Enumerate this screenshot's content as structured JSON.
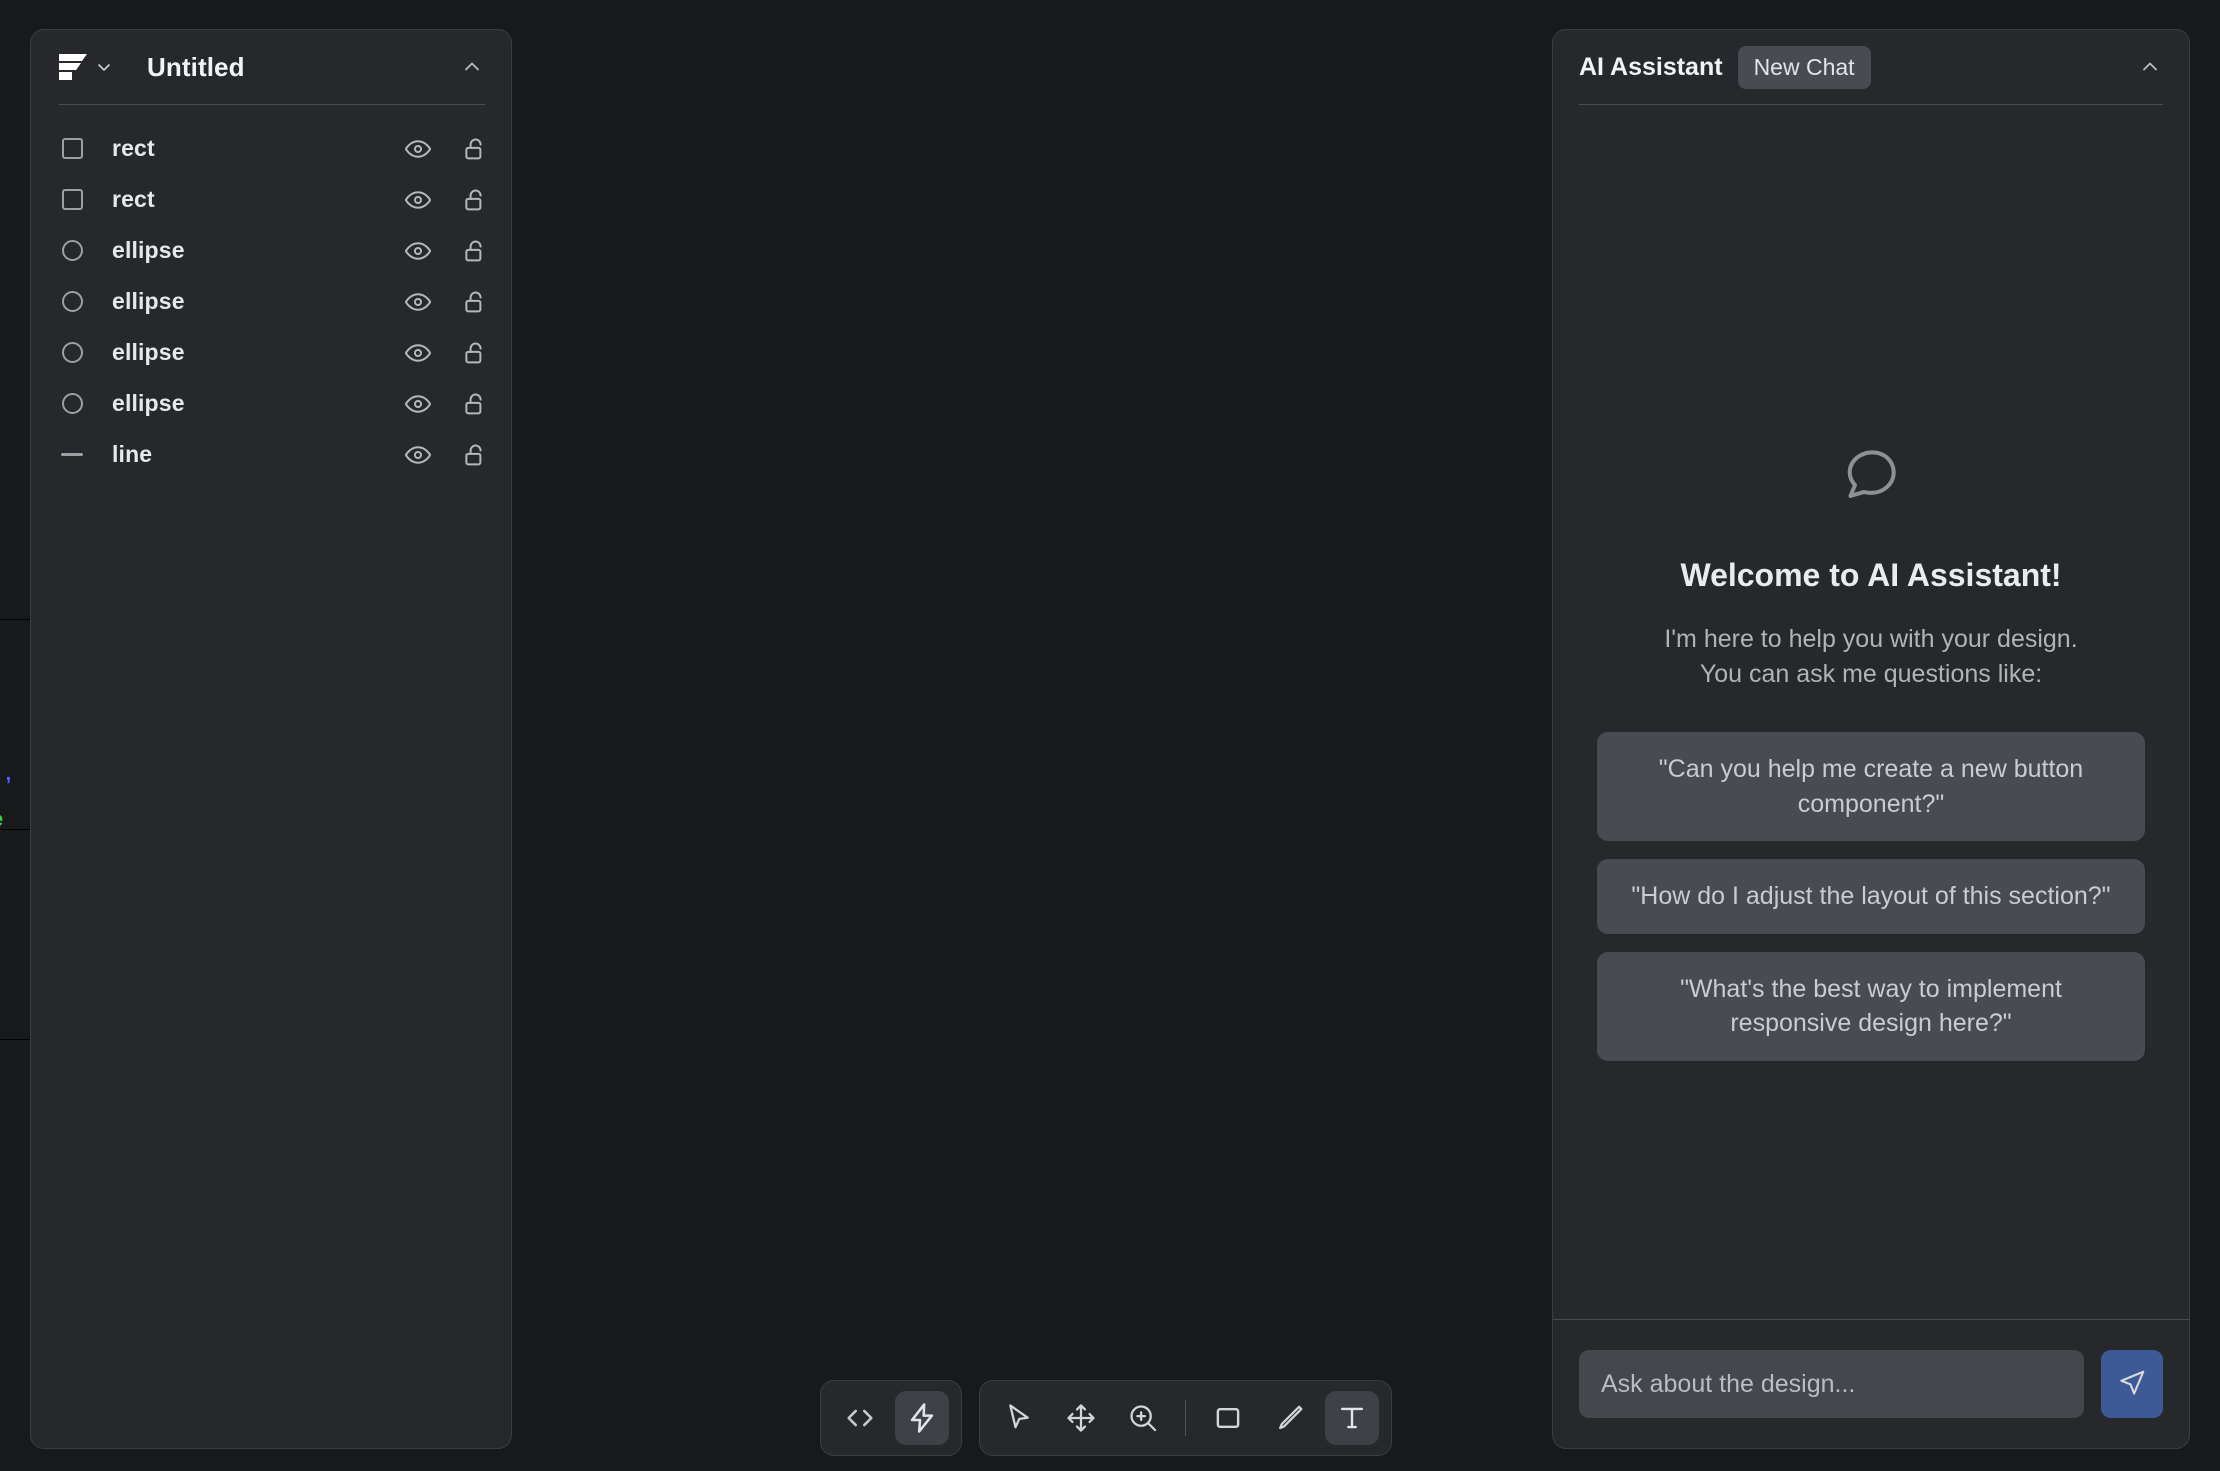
{
  "hidden_panel": {
    "text_blue": "ob ,",
    "text_green": "ice"
  },
  "layers_panel": {
    "logo_icon": "layers-logo-icon",
    "dropdown_icon": "chevron-down-icon",
    "title": "Untitled",
    "collapse_icon": "chevron-up-icon",
    "layers": [
      {
        "name": "rect",
        "shape": "square",
        "visibility_icon": "eye-icon",
        "lock_icon": "unlock-icon"
      },
      {
        "name": "rect",
        "shape": "square",
        "visibility_icon": "eye-icon",
        "lock_icon": "unlock-icon"
      },
      {
        "name": "ellipse",
        "shape": "circle",
        "visibility_icon": "eye-icon",
        "lock_icon": "unlock-icon"
      },
      {
        "name": "ellipse",
        "shape": "circle",
        "visibility_icon": "eye-icon",
        "lock_icon": "unlock-icon"
      },
      {
        "name": "ellipse",
        "shape": "circle",
        "visibility_icon": "eye-icon",
        "lock_icon": "unlock-icon"
      },
      {
        "name": "ellipse",
        "shape": "circle",
        "visibility_icon": "eye-icon",
        "lock_icon": "unlock-icon"
      },
      {
        "name": "line",
        "shape": "line",
        "visibility_icon": "eye-icon",
        "lock_icon": "unlock-icon"
      }
    ]
  },
  "toolbar": {
    "mode_group": [
      {
        "icon": "code-icon",
        "label": "Code",
        "active": false
      },
      {
        "icon": "lightning-icon",
        "label": "Actions",
        "active": true
      }
    ],
    "tool_group": [
      {
        "icon": "cursor-icon",
        "label": "Select",
        "active": false
      },
      {
        "icon": "move-icon",
        "label": "Move",
        "active": false
      },
      {
        "icon": "zoom-in-icon",
        "label": "Zoom",
        "active": false
      },
      {
        "icon": "rectangle-icon",
        "label": "Rectangle",
        "active": false
      },
      {
        "icon": "pen-icon",
        "label": "Pen",
        "active": false
      },
      {
        "icon": "text-icon",
        "label": "Text",
        "active": true
      }
    ]
  },
  "ai_panel": {
    "title": "AI Assistant",
    "new_chat_label": "New Chat",
    "collapse_icon": "chevron-up-icon",
    "empty_state": {
      "icon": "speech-bubble-icon",
      "heading": "Welcome to AI Assistant!",
      "subtitle_line1": "I'm here to help you with your design.",
      "subtitle_line2": "You can ask me questions like:"
    },
    "suggestions": [
      "\"Can you help me create a new button component?\"",
      "\"How do I adjust the layout of this section?\"",
      "\"What's the best way to implement responsive design here?\""
    ],
    "input": {
      "value": "",
      "placeholder": "Ask about the design...",
      "send_icon": "send-icon"
    }
  },
  "colors": {
    "canvas_bg": "#17191b",
    "panel_bg": "#26282b",
    "panel_border": "#3a3d42",
    "chip_bg": "#4a4a52",
    "accent_blue": "#3d5a96",
    "text_blue": "#4b63f0",
    "text_green": "#39d353"
  }
}
